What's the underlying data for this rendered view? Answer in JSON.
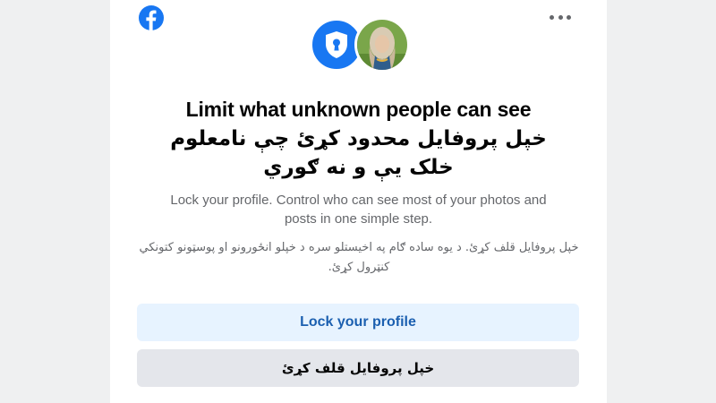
{
  "app": {
    "logo_icon": "facebook-logo-icon",
    "menu_icon": "more-options-icon"
  },
  "colors": {
    "brand": "#1877f2",
    "primary_button_bg": "#e7f3ff",
    "primary_button_text": "#1b5fb0",
    "secondary_button_bg": "#e4e6eb"
  },
  "header": {
    "lock_icon": "shield-keyhole-icon",
    "avatar": "profile-photo"
  },
  "title": {
    "en": "Limit what unknown people can see",
    "ps_line1": "خپل پروفایل محدود کړئ چې نامعلوم",
    "ps_line2": "خلک یې و نه ګوري"
  },
  "description": {
    "en": "Lock your profile. Control who can see most of your photos and posts in one simple step.",
    "ps": "خپل پروفایل قلف کړئ. د یوه ساده ګام په اخیستلو سره د خپلو انځورونو او پوسټونو کتونکي کنټرول کړئ."
  },
  "buttons": {
    "lock_label": "Lock your profile",
    "lock_label_ps": "خپل پروفایل قلف کړئ"
  }
}
